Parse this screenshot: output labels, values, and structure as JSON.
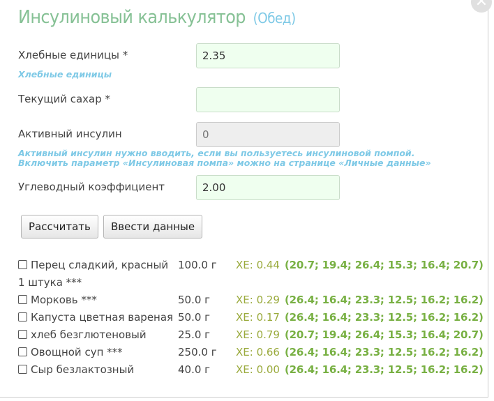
{
  "title": "Инсулиновый калькулятор",
  "meal": "(Обед)",
  "close_label": "✕",
  "fields": {
    "bread_units": {
      "label": "Хлебные единицы *",
      "value": "2.35",
      "hint": "Хлебные единицы"
    },
    "current_sugar": {
      "label": "Текущий сахар *",
      "value": ""
    },
    "active_insulin": {
      "label": "Активный инсулин",
      "placeholder": "0",
      "hint": "Активный инсулин нужно вводить, если вы пользуетесь инсулиновой помпой. Включить параметр «Инсулиновая помпа» можно на странице «Личные данные»"
    },
    "carb_ratio": {
      "label": "Углеводный коэффициент",
      "value": "2.00"
    }
  },
  "buttons": {
    "calculate": "Рассчитать",
    "enter_data": "Ввести данные"
  },
  "products": [
    {
      "name": "Перец сладкий, красный 1 штука ***",
      "weight": "100.0 г",
      "xe": "ХЕ: 0.44",
      "nums": "(20.7; 19.4; 26.4; 15.3; 16.4; 20.7)"
    },
    {
      "name": "Морковь ***",
      "weight": "50.0 г",
      "xe": "ХЕ: 0.29",
      "nums": "(26.4; 16.4; 23.3; 12.5; 16.2; 16.2)"
    },
    {
      "name": "Капуста цветная вареная",
      "weight": "50.0 г",
      "xe": "ХЕ: 0.17",
      "nums": "(26.4; 16.4; 23.3; 12.5; 16.2; 16.2)"
    },
    {
      "name": "хлеб безглютеновый",
      "weight": "25.0 г",
      "xe": "ХЕ: 0.79",
      "nums": "(20.7; 19.4; 26.4; 15.3; 16.4; 20.7)"
    },
    {
      "name": "Овощной суп ***",
      "weight": "250.0 г",
      "xe": "ХЕ: 0.66",
      "nums": "(26.4; 16.4; 23.3; 12.5; 16.2; 16.2)"
    },
    {
      "name": "Сыр безлактозный",
      "weight": "40.0 г",
      "xe": "ХЕ: 0.00",
      "nums": "(26.4; 16.4; 23.3; 12.5; 16.2; 16.2)"
    }
  ],
  "colors": {
    "title": "#86c195",
    "hint": "#7ec9e6",
    "input_bg": "#efffef",
    "xe": "#9aaa3c",
    "nums": "#78b043"
  }
}
